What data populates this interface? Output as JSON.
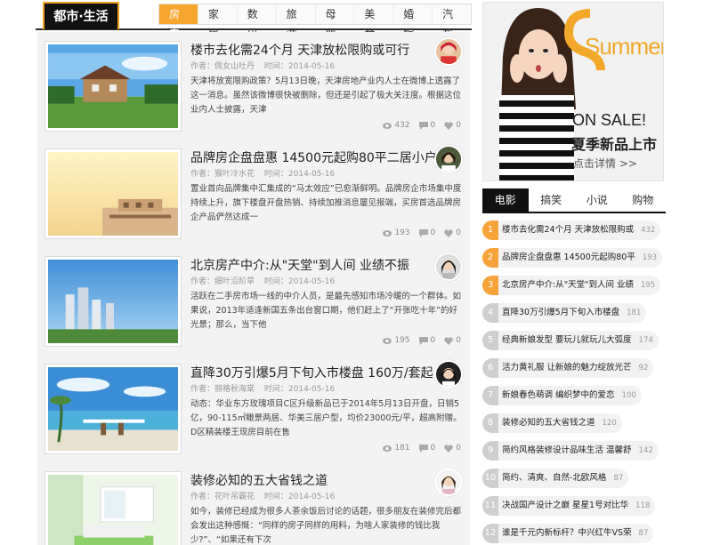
{
  "header": {
    "section_title": "都市·生活",
    "tabs": [
      "房产",
      "家居",
      "数码",
      "旅游",
      "母婴",
      "美食",
      "婚嫁",
      "汽车"
    ],
    "active_tab": "房产"
  },
  "articles": [
    {
      "title": "楼市去化需24个月 天津放松限购或可行",
      "author": "作者：佩女山吐丹",
      "time": "时间：2014-05-16",
      "excerpt": "天津将放宽限购政策？5月13日晚，天津房地产业内人士在微博上透露了这一消息。虽然该微博很快被删除，但还是引起了极大关注度。根据这位业内人士披露，天津",
      "views": "432",
      "comments": "0",
      "likes": "0"
    },
    {
      "title": "品牌房企盘盘惠 14500元起购80平二居小户",
      "author": "作者：猴叶冷水花",
      "time": "时间：2014-05-16",
      "excerpt": "置业首向品牌集中汇集成的“马太效应”已愈渐鲜明。品牌房企市场集中度持续上升，旗下楼盘开盘热销、持续加推消息屡见报端，买房首选品牌房企产品俨然达成一",
      "views": "193",
      "comments": "0",
      "likes": "0"
    },
    {
      "title": "北京房产中介:从\"天堂\"到人间 业绩不振",
      "author": "作者：细叶沿阶草",
      "time": "时间：2014-05-16",
      "excerpt": "活跃在二手房市场一线的中介人员，是最先感知市场冷暖的一个群体。如果说，2013年适逢新国五条出台窗口期，他们赶上了“开张吃十年”的好光景；那么，当下他",
      "views": "195",
      "comments": "0",
      "likes": "0"
    },
    {
      "title": "直降30万引爆5月下旬入市楼盘 160万/套起",
      "author": "作者：丽格秋海棠",
      "time": "时间：2014-05-16",
      "excerpt": "动态：华业东方玫瑰项目C区升级新品已于2014年5月13日开盘，日销5亿，90-115㎡瞰景两居、华美三居户型，均价23000元/平，超高附赠。D区精装楼王现房目前在售",
      "views": "181",
      "comments": "0",
      "likes": "0"
    },
    {
      "title": "装修必知的五大省钱之道",
      "author": "作者：花叶吊霸花",
      "time": "时间：2014-05-16",
      "excerpt": "如今，装修已经成为很多人茶余饭后讨论的话题，很多朋友在装修完后都会发出这种感慨：“同样的房子同样的用料，为啥人家装修的钱比我少?”、“如果还有下次",
      "views": "",
      "comments": "",
      "likes": ""
    }
  ],
  "ad": {
    "headline": "Summer",
    "sale": "ON SALE!",
    "subtitle": "夏季新品上市",
    "cta": "点击详情 >>",
    "accent": "#f3a82a"
  },
  "sidebar": {
    "tabs": [
      "电影",
      "搞笑",
      "小说",
      "购物"
    ],
    "active_tab": "电影",
    "ranking": [
      {
        "num": "1",
        "text": "楼市去化需24个月 天津放松限购或",
        "count": "432"
      },
      {
        "num": "2",
        "text": "品牌房企盘盘惠 14500元起购80平",
        "count": "193"
      },
      {
        "num": "3",
        "text": "北京房产中介:从\"天堂\"到人间 业绩",
        "count": "195"
      },
      {
        "num": "4",
        "text": "直降30万引爆5月下旬入市楼盘",
        "count": "181"
      },
      {
        "num": "5",
        "text": "经典新娘发型 要玩儿就玩儿大弧度",
        "count": "174"
      },
      {
        "num": "6",
        "text": "活力黄礼服 让新娘的魅力绽放光芒",
        "count": "92"
      },
      {
        "num": "7",
        "text": "新娘春色萌调 编织梦中的爱恋",
        "count": "100"
      },
      {
        "num": "8",
        "text": "装修必知的五大省钱之道",
        "count": "120"
      },
      {
        "num": "9",
        "text": "简约风格装修设计品味生活 温馨舒",
        "count": "142"
      },
      {
        "num": "10",
        "text": "简约、清爽、自然-北欧风格",
        "count": "87"
      },
      {
        "num": "11",
        "text": "决战国产设计之巅 星星1号对比华",
        "count": "118"
      },
      {
        "num": "12",
        "text": "谁是千元内新标杆？中兴红牛VS荣",
        "count": "87"
      }
    ]
  },
  "colors": {
    "accent_orange": "#f7a72e",
    "dark": "#111111"
  }
}
